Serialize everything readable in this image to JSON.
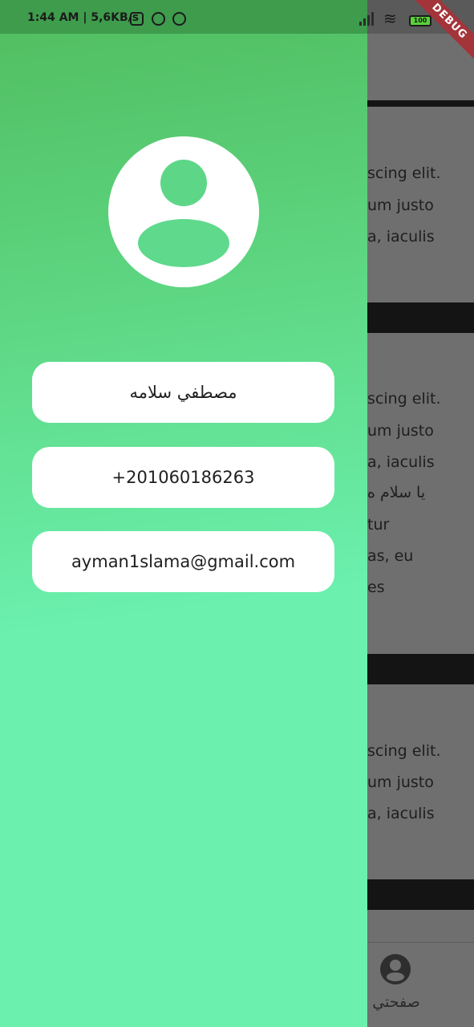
{
  "status_bar": {
    "time_speed": "1:44 AM | 5,6KB/s",
    "battery": "100",
    "debug_banner": "DEBUG"
  },
  "background_page": {
    "card_lines": [
      [
        "scing elit.",
        "um justo",
        "a, iaculis"
      ],
      [
        "scing elit.",
        "um justo",
        "a, iaculis",
        "يا سلام ه",
        "tur",
        "as, eu",
        "es"
      ],
      [
        "scing elit.",
        "um justo",
        "a, iaculis"
      ]
    ],
    "bottom_nav": {
      "label": "صفحتي",
      "icon": "account-circle-icon"
    }
  },
  "drawer": {
    "avatar_icon": "account-circle-icon",
    "name": "مصطفي سلامه",
    "phone": "+201060186263",
    "email": "ayman1slama@gmail.com"
  },
  "colors": {
    "drawer_top": "#52bf62",
    "drawer_bottom": "#6bf0ae",
    "scrim": "#6f6f6f",
    "divider": "#141414",
    "card": "#ffffff",
    "debug": "#a3343a"
  }
}
